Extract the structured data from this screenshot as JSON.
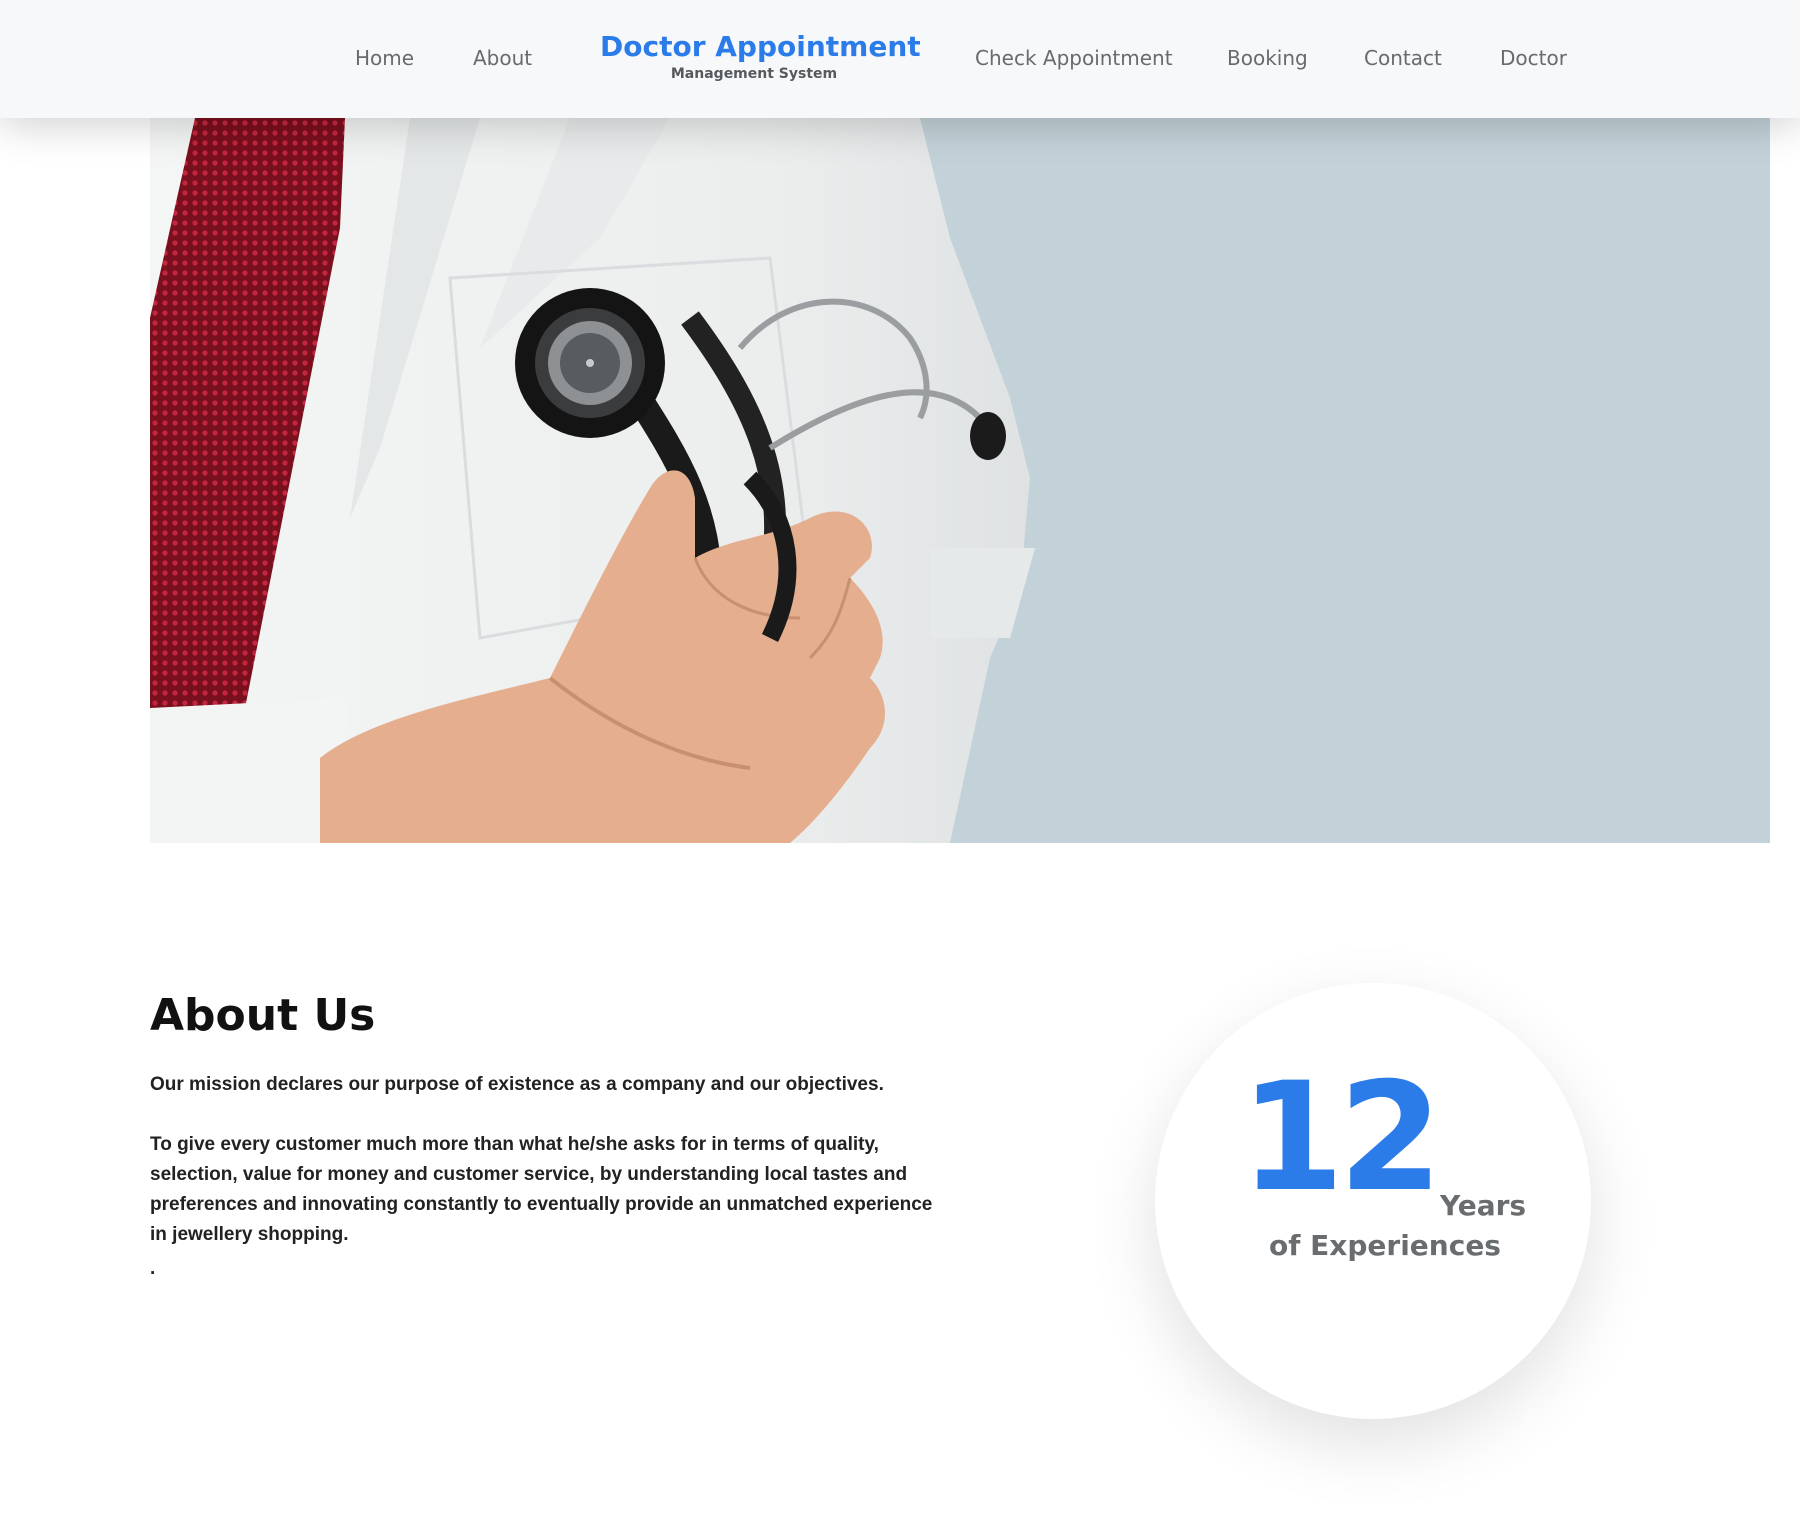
{
  "nav": {
    "home": "Home",
    "about": "About",
    "brand_title": "Doctor Appointment",
    "brand_subtitle": "Management System",
    "check_appointment": "Check Appointment",
    "booking": "Booking",
    "contact": "Contact",
    "doctor": "Doctor"
  },
  "colors": {
    "brand_blue": "#2b7ce9",
    "hero_background": "#c3d2d9",
    "nav_background": "#f7f8f9"
  },
  "about": {
    "title": "About Us",
    "mission": "Our mission declares our purpose of existence as a company and our objectives.",
    "goal": "To give every customer much more than what he/she asks for in terms of quality, selection, value for money and customer service, by understanding local tastes and preferences and innovating constantly to eventually provide an unmatched experience in jewellery shopping.",
    "dot": "."
  },
  "experience": {
    "number": "12",
    "unit": "Years",
    "label": "of Experiences"
  }
}
